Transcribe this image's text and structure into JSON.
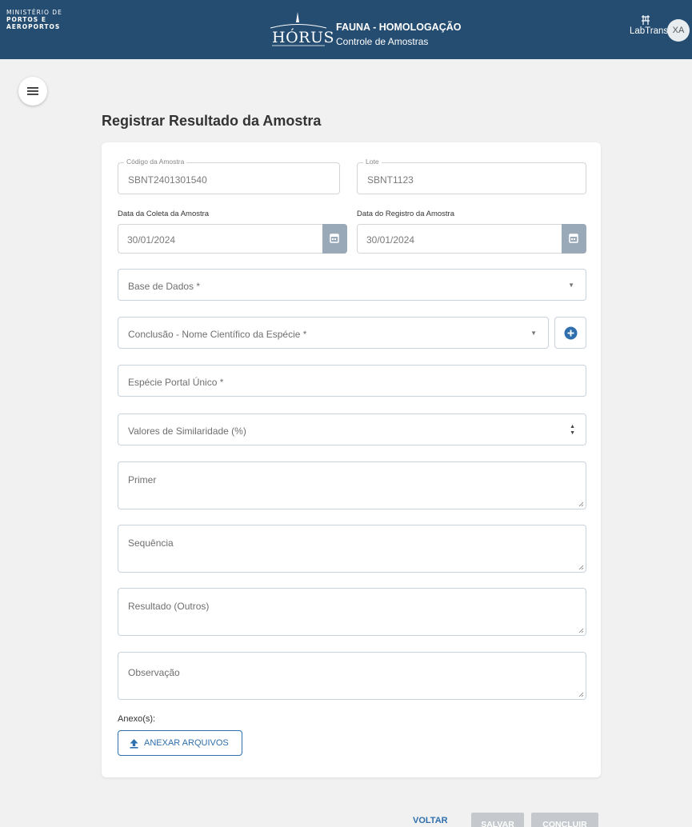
{
  "header": {
    "ministry_line1": "MINISTÉRIO DE",
    "ministry_line2": "PORTOS E",
    "ministry_line3": "AEROPORTOS",
    "logo_text": "HÓRUS",
    "app_title": "FAUNA - HOMOLOGAÇÃO",
    "app_subtitle": "Controle de Amostras",
    "partner": "LabTrans",
    "user_initials": "XA",
    "color": "#254d72"
  },
  "menu": {
    "icon": "hamburger-icon"
  },
  "page": {
    "title": "Registrar Resultado da Amostra"
  },
  "form": {
    "codigo": {
      "label": "Código da Amostra",
      "value": "SBNT2401301540"
    },
    "lote": {
      "label": "Lote",
      "value": "SBNT1123"
    },
    "data_coleta": {
      "label": "Data da Coleta da Amostra",
      "value": "30/01/2024"
    },
    "data_registro": {
      "label": "Data do Registro da Amostra",
      "value": "30/01/2024"
    },
    "base_dados": {
      "placeholder": "Base de Dados *"
    },
    "conclusao": {
      "placeholder": "Conclusão - Nome Científico da Espécie *"
    },
    "especie_portal": {
      "placeholder": "Espécie Portal Único *"
    },
    "similaridade": {
      "placeholder": "Valores de Similaridade (%)"
    },
    "primer": {
      "placeholder": "Primer"
    },
    "sequencia": {
      "placeholder": "Sequência"
    },
    "resultado_outros": {
      "placeholder": "Resultado (Outros)"
    },
    "observacao": {
      "placeholder": "Observação"
    },
    "anexos_label": "Anexo(s):",
    "attach_button": "ANEXAR ARQUIVOS"
  },
  "actions": {
    "back": "VOLTAR",
    "save": "SALVAR",
    "finish": "CONCLUIR"
  },
  "colors": {
    "accent": "#2f6fad",
    "disabled": "#c5c8cc",
    "calendar": "#9aa9b8"
  }
}
